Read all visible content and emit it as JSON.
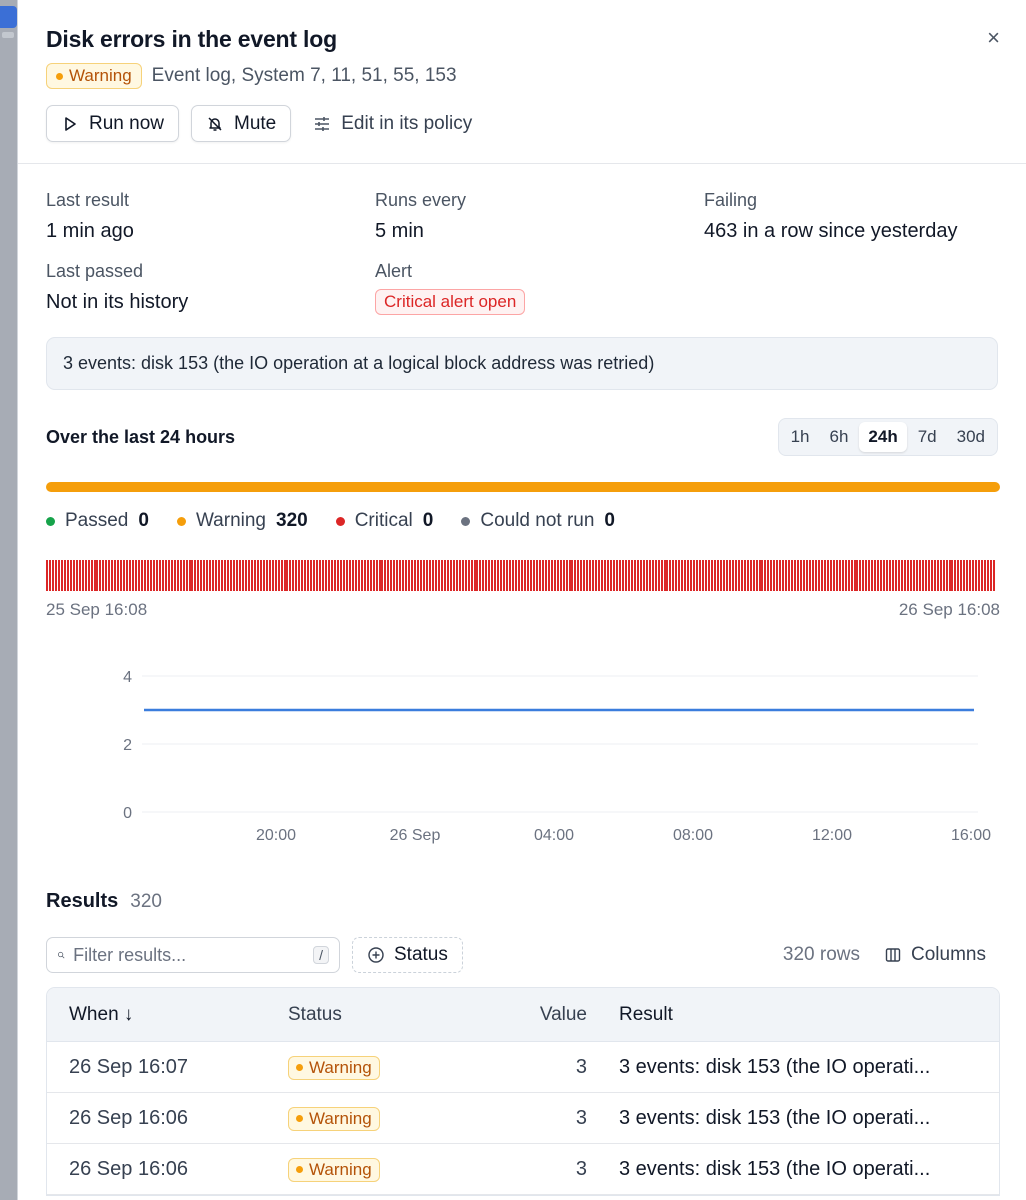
{
  "header": {
    "title": "Disk errors in the event log",
    "status_badge": "Warning",
    "subtitle": "Event log, System 7, 11, 51, 55, 153",
    "close_glyph": "×",
    "actions": {
      "run_now": "Run now",
      "mute": "Mute",
      "edit_policy": "Edit in its policy"
    }
  },
  "meta": {
    "last_result": {
      "label": "Last result",
      "value": "1 min ago"
    },
    "runs_every": {
      "label": "Runs every",
      "value": "5 min"
    },
    "failing": {
      "label": "Failing",
      "value": "463 in a row since yesterday"
    },
    "last_passed": {
      "label": "Last passed",
      "value": "Not in its history"
    },
    "alert": {
      "label": "Alert",
      "value": "Critical alert open"
    }
  },
  "message": "3 events: disk 153 (the IO operation at a logical block address was retried)",
  "range": {
    "title": "Over the last 24 hours",
    "options": [
      "1h",
      "6h",
      "24h",
      "7d",
      "30d"
    ],
    "selected": "24h"
  },
  "summary": {
    "bar_fraction_warning": 1.0,
    "legend": [
      {
        "label": "Passed",
        "count": "0",
        "color": "#16a34a"
      },
      {
        "label": "Warning",
        "count": "320",
        "color": "#f59e0b"
      },
      {
        "label": "Critical",
        "count": "0",
        "color": "#dc2626"
      },
      {
        "label": "Could not run",
        "count": "0",
        "color": "#6b7280"
      }
    ]
  },
  "timeline": {
    "start_label": "25 Sep 16:08",
    "end_label": "26 Sep 16:08",
    "tick_color": "#dc2626"
  },
  "chart_data": {
    "type": "line",
    "x_tick_labels": [
      "20:00",
      "26 Sep",
      "04:00",
      "08:00",
      "12:00",
      "16:00"
    ],
    "y_tick_labels": [
      "0",
      "2",
      "4"
    ],
    "ylim": [
      0,
      4
    ],
    "grid": true,
    "series": [
      {
        "color": "#3b7ddd",
        "x": [
          "25 Sep 16:08",
          "26 Sep 16:08"
        ],
        "values": [
          3,
          3
        ]
      }
    ]
  },
  "results": {
    "title": "Results",
    "count": "320",
    "search_placeholder": "Filter results...",
    "search_shortcut": "/",
    "status_filter": "Status",
    "rows_label": "320 rows",
    "columns_label": "Columns",
    "columns": {
      "when": "When ↓",
      "status": "Status",
      "value": "Value",
      "result": "Result"
    },
    "rows": [
      {
        "when": "26 Sep 16:07",
        "status": "Warning",
        "value": "3",
        "result": "3 events: disk 153 (the IO operati..."
      },
      {
        "when": "26 Sep 16:06",
        "status": "Warning",
        "value": "3",
        "result": "3 events: disk 153 (the IO operati..."
      },
      {
        "when": "26 Sep 16:06",
        "status": "Warning",
        "value": "3",
        "result": "3 events: disk 153 (the IO operati..."
      }
    ]
  }
}
